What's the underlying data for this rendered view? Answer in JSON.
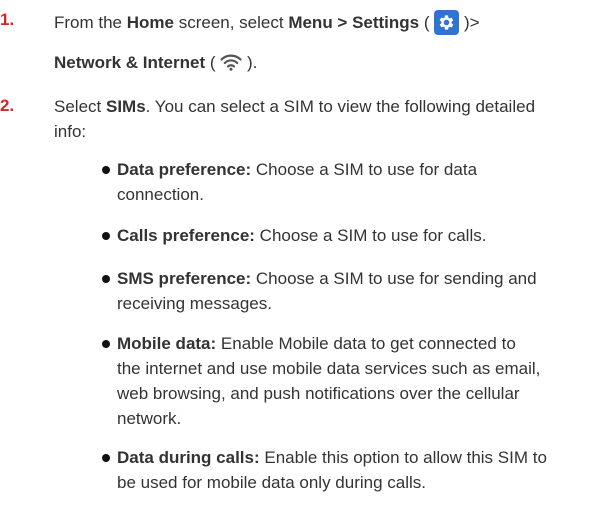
{
  "steps": [
    {
      "number": "1.",
      "line1_pre": "From the ",
      "line1_home": "Home",
      "line1_mid": " screen, select ",
      "line1_menu": "Menu > Settings",
      "line1_open": " (",
      "line1_close": ")>",
      "line2_network": "Network & Internet",
      "line2_open": " (",
      "line2_close": " )."
    },
    {
      "number": "2.",
      "line1_pre": "Select ",
      "line1_sims": "SIMs",
      "line1_rest": ". You can select a SIM to view the following detailed",
      "line2": "info:"
    }
  ],
  "bullets": [
    {
      "bold": "Data preference:",
      "lines": [
        " Choose a SIM to use for data",
        "connection."
      ]
    },
    {
      "bold": "Calls preference:",
      "lines": [
        " Choose a SIM to use for calls."
      ]
    },
    {
      "bold": "SMS preference:",
      "lines": [
        " Choose a SIM to use for sending and",
        "receiving messages."
      ]
    },
    {
      "bold": "Mobile data:",
      "lines": [
        " Enable Mobile data to get connected to",
        "the internet and use mobile data services such as email,",
        "web browsing, and push notifications over the cellular",
        "network."
      ]
    },
    {
      "bold": "Data during calls:",
      "lines": [
        " Enable this option to allow this SIM to",
        "be used for mobile data only during calls."
      ]
    }
  ],
  "colors": {
    "step_number": "#d22828",
    "settings_icon_bg": "#2f74d0"
  },
  "icons": [
    "gear-icon",
    "wifi-icon"
  ]
}
